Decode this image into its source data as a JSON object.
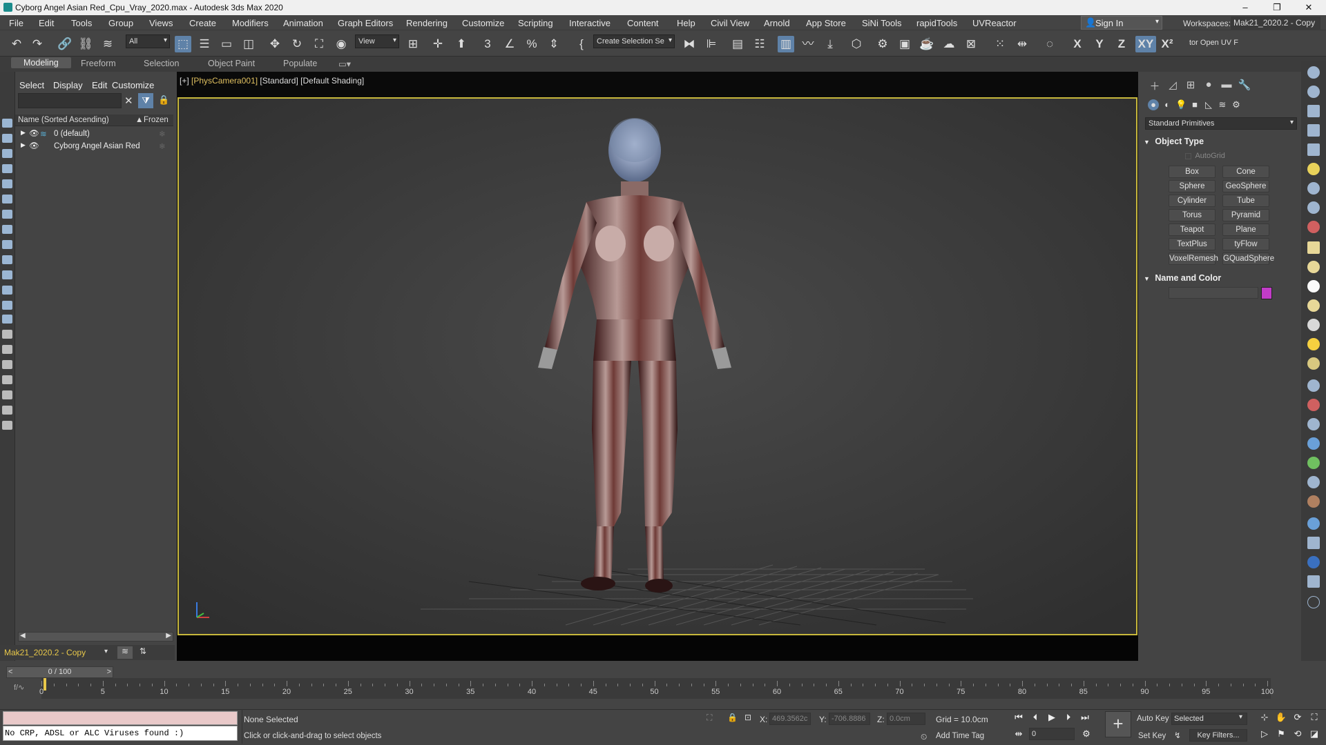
{
  "window": {
    "title": "Cyborg Angel Asian Red_Cpu_Vray_2020.max - Autodesk 3ds Max 2020",
    "minimize": "–",
    "restore": "❐",
    "close": "✕"
  },
  "menu": [
    "File",
    "Edit",
    "Tools",
    "Group",
    "Views",
    "Create",
    "Modifiers",
    "Animation",
    "Graph Editors",
    "Rendering",
    "Customize",
    "Scripting",
    "Interactive",
    "Content",
    "Help",
    "Civil View",
    "Arnold",
    "App Store",
    "SiNi Tools",
    "rapidTools",
    "UVReactor"
  ],
  "account": {
    "sign_in": "Sign In",
    "workspaces_label": "Workspaces:",
    "workspace_value": "Mak21_2020.2 - Copy"
  },
  "toolbar": {
    "filter_value": "All",
    "coord_system": "View",
    "selection_set_placeholder": "Create Selection Se",
    "axis_x": "X",
    "axis_y": "Y",
    "axis_z": "Z",
    "axis_xy": "XY",
    "axis_x2": "X²",
    "uv_tool_label": "tor Open UV F"
  },
  "ribbon": {
    "tabs": [
      "Modeling",
      "Freeform",
      "Selection",
      "Object Paint",
      "Populate"
    ],
    "selected_tab": "Modeling"
  },
  "scene_explorer": {
    "menu": [
      "Select",
      "Display",
      "Edit",
      "Customize"
    ],
    "column_name": "Name (Sorted Ascending)",
    "column_frozen": "Frozen",
    "rows": [
      {
        "name": "0 (default)"
      },
      {
        "name": "Cyborg Angel Asian Red"
      }
    ],
    "layer_value": "Mak21_2020.2 - Copy"
  },
  "viewport": {
    "label_plus": "[+]",
    "label_camera": "[PhysCamera001]",
    "label_standard": "[Standard]",
    "label_shading": "[Default Shading]"
  },
  "command_panel": {
    "category": "Standard Primitives",
    "object_type_title": "Object Type",
    "autogrid": "AutoGrid",
    "buttons": [
      "Box",
      "Cone",
      "Sphere",
      "GeoSphere",
      "Cylinder",
      "Tube",
      "Torus",
      "Pyramid",
      "Teapot",
      "Plane",
      "TextPlus",
      "tyFlow",
      "VoxelRemesh",
      "GQuadSphere"
    ],
    "name_color_title": "Name and Color",
    "object_color": "#c23cc8"
  },
  "timeline": {
    "slider_text": "0 / 100",
    "ticks": [
      0,
      5,
      10,
      15,
      20,
      25,
      30,
      35,
      40,
      45,
      50,
      55,
      60,
      65,
      70,
      75,
      80,
      85,
      90,
      95,
      100
    ]
  },
  "status": {
    "maxscript_output": "No CRP, ADSL or ALC Viruses found :)",
    "selection": "None Selected",
    "prompt": "Click or click-and-drag to select objects",
    "x_label": "X:",
    "x_value": "469.3562c",
    "y_label": "Y:",
    "y_value": "-706.8886",
    "z_label": "Z:",
    "z_value": "0.0cm",
    "grid": "Grid = 10.0cm",
    "add_time_tag": "Add Time Tag",
    "auto_key": "Auto Key",
    "set_key": "Set Key",
    "key_mode": "Selected",
    "key_filters": "Key Filters...",
    "frame": "0"
  },
  "colors": {
    "viewport_border": "#c8b83c",
    "active_tool": "#5f82a8",
    "camera_label": "#e0c060"
  }
}
